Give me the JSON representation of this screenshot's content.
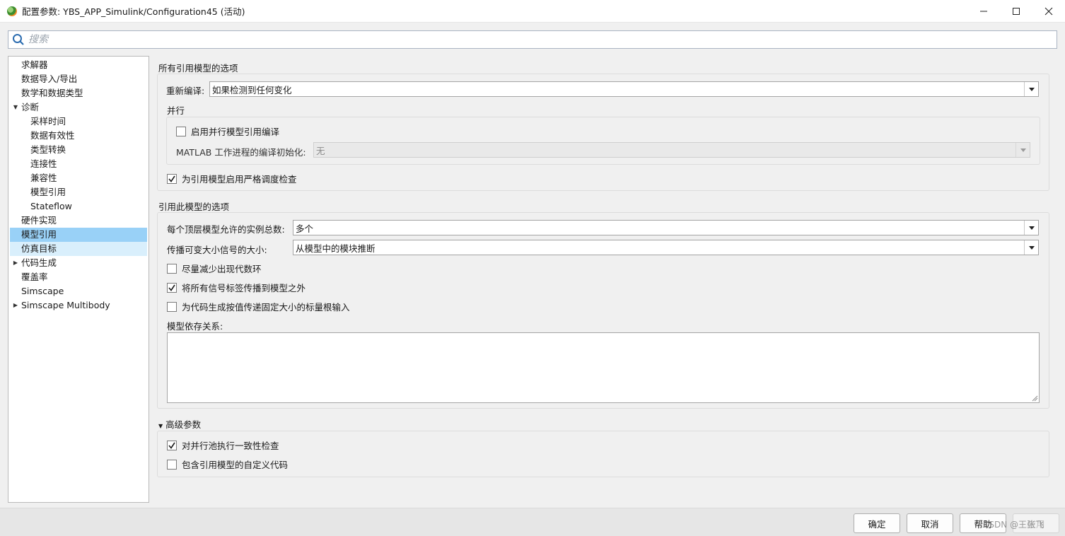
{
  "window": {
    "title": "配置参数: YBS_APP_Simulink/Configuration45 (活动)",
    "controls": {
      "minimize": "—",
      "maximize": "☐",
      "close": "✕"
    }
  },
  "search": {
    "placeholder": "搜索",
    "value": ""
  },
  "tree": {
    "items": [
      {
        "label": "求解器",
        "level": 0,
        "expander": ""
      },
      {
        "label": "数据导入/导出",
        "level": 0,
        "expander": ""
      },
      {
        "label": "数学和数据类型",
        "level": 0,
        "expander": ""
      },
      {
        "label": "诊断",
        "level": 0,
        "expander": "expanded"
      },
      {
        "label": "采样时间",
        "level": 1,
        "expander": ""
      },
      {
        "label": "数据有效性",
        "level": 1,
        "expander": ""
      },
      {
        "label": "类型转换",
        "level": 1,
        "expander": ""
      },
      {
        "label": "连接性",
        "level": 1,
        "expander": ""
      },
      {
        "label": "兼容性",
        "level": 1,
        "expander": ""
      },
      {
        "label": "模型引用",
        "level": 1,
        "expander": ""
      },
      {
        "label": "Stateflow",
        "level": 1,
        "expander": ""
      },
      {
        "label": "硬件实现",
        "level": 0,
        "expander": ""
      },
      {
        "label": "模型引用",
        "level": 0,
        "expander": "",
        "state": "selected"
      },
      {
        "label": "仿真目标",
        "level": 0,
        "expander": "",
        "state": "hover"
      },
      {
        "label": "代码生成",
        "level": 0,
        "expander": "collapsed"
      },
      {
        "label": "覆盖率",
        "level": 0,
        "expander": ""
      },
      {
        "label": "Simscape",
        "level": 0,
        "expander": ""
      },
      {
        "label": "Simscape Multibody",
        "level": 0,
        "expander": "collapsed"
      }
    ]
  },
  "all_refs": {
    "title": "所有引用模型的选项",
    "rebuild_label": "重新编译:",
    "rebuild_value": "如果检测到任何变化",
    "parallel": {
      "title": "并行",
      "enable_label": "启用并行模型引用编译",
      "enable_checked": false,
      "matlab_init_label": "MATLAB 工作进程的编译初始化:",
      "matlab_init_value": "无"
    },
    "strict_label": "为引用模型启用严格调度检查",
    "strict_checked": true
  },
  "this_model": {
    "title": "引用此模型的选项",
    "instances_label": "每个顶层模型允许的实例总数:",
    "instances_value": "多个",
    "propagate_label": "传播可变大小信号的大小:",
    "propagate_value": "从模型中的模块推断",
    "minimize_loops_label": "尽量减少出现代数环",
    "minimize_loops_checked": false,
    "propagate_names_label": "将所有信号标签传播到模型之外",
    "propagate_names_checked": true,
    "pass_by_value_label": "为代码生成按值传递固定大小的标量根输入",
    "pass_by_value_checked": false,
    "dependencies_label": "模型依存关系:",
    "dependencies_value": ""
  },
  "advanced": {
    "title": "高级参数",
    "consistency_label": "对并行池执行一致性检查",
    "consistency_checked": true,
    "custom_code_label": "包含引用模型的自定义代码",
    "custom_code_checked": false
  },
  "buttons": {
    "ok": "确定",
    "cancel": "取消",
    "help": "帮助",
    "apply": "应用"
  },
  "watermark": "CSDN @王张飞",
  "colors": {
    "selected": "#99d1f7",
    "hover": "#d9effc",
    "accent": "#1e6fc2"
  },
  "icons": {
    "check": "check-icon",
    "dropdown": "dropdown-arrow-icon",
    "search": "search-icon"
  }
}
